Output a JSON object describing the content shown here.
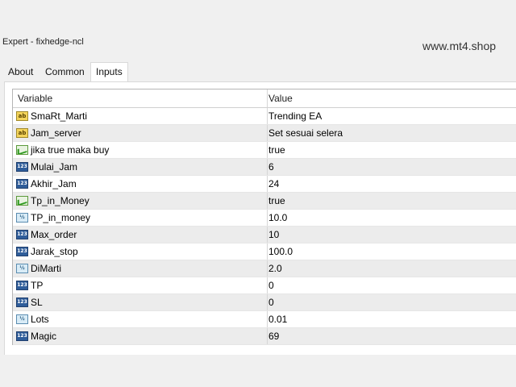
{
  "window": {
    "title": "Expert - fixhedge-ncl",
    "watermark": "www.mt4.shop"
  },
  "tabs": [
    {
      "label": "About",
      "active": false
    },
    {
      "label": "Common",
      "active": false
    },
    {
      "label": "Inputs",
      "active": true
    }
  ],
  "table": {
    "columns": [
      "Variable",
      "Value"
    ],
    "rows": [
      {
        "type": "string",
        "icon": "string-type-icon",
        "badge": "ab",
        "variable": "SmaRt_Marti",
        "value": "Trending EA"
      },
      {
        "type": "string",
        "icon": "string-type-icon",
        "badge": "ab",
        "variable": "Jam_server",
        "value": "Set sesuai selera"
      },
      {
        "type": "bool",
        "icon": "bool-type-icon",
        "badge": "",
        "variable": "jika true maka buy",
        "value": "true"
      },
      {
        "type": "int",
        "icon": "int-type-icon",
        "badge": "123",
        "variable": "Mulai_Jam",
        "value": "6"
      },
      {
        "type": "int",
        "icon": "int-type-icon",
        "badge": "123",
        "variable": "Akhir_Jam",
        "value": "24"
      },
      {
        "type": "bool",
        "icon": "bool-type-icon",
        "badge": "",
        "variable": "Tp_in_Money",
        "value": "true"
      },
      {
        "type": "double",
        "icon": "double-type-icon",
        "badge": "½",
        "variable": "TP_in_money",
        "value": "10.0"
      },
      {
        "type": "int",
        "icon": "int-type-icon",
        "badge": "123",
        "variable": "Max_order",
        "value": "10"
      },
      {
        "type": "int",
        "icon": "int-type-icon",
        "badge": "123",
        "variable": "Jarak_stop",
        "value": "100.0"
      },
      {
        "type": "double",
        "icon": "double-type-icon",
        "badge": "½",
        "variable": "DiMarti",
        "value": "2.0"
      },
      {
        "type": "int",
        "icon": "int-type-icon",
        "badge": "123",
        "variable": "TP",
        "value": "0"
      },
      {
        "type": "int",
        "icon": "int-type-icon",
        "badge": "123",
        "variable": "SL",
        "value": "0"
      },
      {
        "type": "double",
        "icon": "double-type-icon",
        "badge": "½",
        "variable": "Lots",
        "value": "0.01"
      },
      {
        "type": "int",
        "icon": "int-type-icon",
        "badge": "123",
        "variable": "Magic",
        "value": "69"
      }
    ]
  }
}
